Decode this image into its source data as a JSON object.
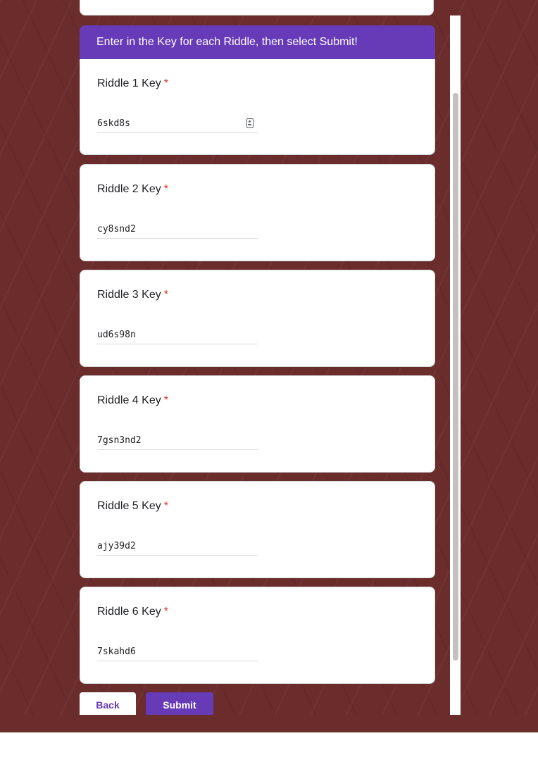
{
  "section": {
    "header": "Enter in the Key for each Riddle, then select Submit!"
  },
  "questions": [
    {
      "label": "Riddle 1 Key",
      "required": "*",
      "value": "6skd8s"
    },
    {
      "label": "Riddle 2 Key",
      "required": "*",
      "value": "cy8snd2"
    },
    {
      "label": "Riddle 3 Key",
      "required": "*",
      "value": "ud6s98n"
    },
    {
      "label": "Riddle 4 Key",
      "required": "*",
      "value": "7gsn3nd2"
    },
    {
      "label": "Riddle 5 Key",
      "required": "*",
      "value": "ajy39d2"
    },
    {
      "label": "Riddle 6 Key",
      "required": "*",
      "value": "7skahd6"
    }
  ],
  "buttons": {
    "back": "Back",
    "submit": "Submit"
  },
  "icons": {
    "autofill": "password-key-icon"
  },
  "colors": {
    "accent": "#673ab7",
    "required": "#d93025",
    "background": "#6b2c2c"
  }
}
